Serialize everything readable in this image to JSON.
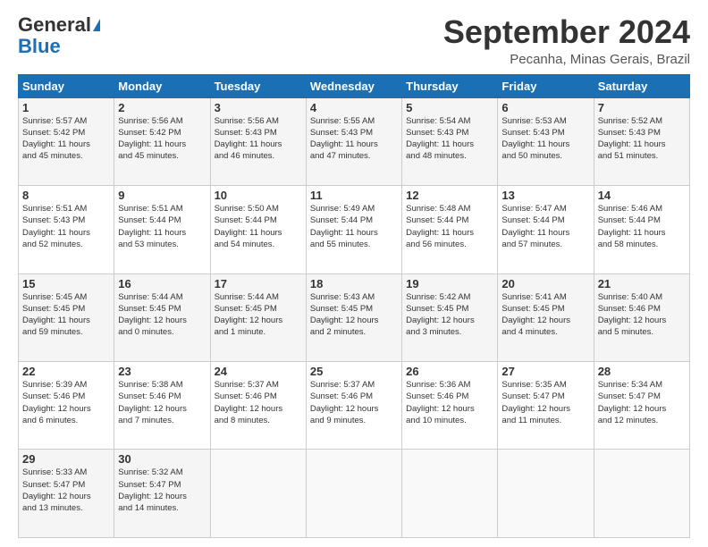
{
  "header": {
    "logo_line1": "General",
    "logo_line2": "Blue",
    "month": "September 2024",
    "location": "Pecanha, Minas Gerais, Brazil"
  },
  "weekdays": [
    "Sunday",
    "Monday",
    "Tuesday",
    "Wednesday",
    "Thursday",
    "Friday",
    "Saturday"
  ],
  "weeks": [
    [
      {
        "day": "1",
        "info": "Sunrise: 5:57 AM\nSunset: 5:42 PM\nDaylight: 11 hours\nand 45 minutes."
      },
      {
        "day": "2",
        "info": "Sunrise: 5:56 AM\nSunset: 5:42 PM\nDaylight: 11 hours\nand 45 minutes."
      },
      {
        "day": "3",
        "info": "Sunrise: 5:56 AM\nSunset: 5:43 PM\nDaylight: 11 hours\nand 46 minutes."
      },
      {
        "day": "4",
        "info": "Sunrise: 5:55 AM\nSunset: 5:43 PM\nDaylight: 11 hours\nand 47 minutes."
      },
      {
        "day": "5",
        "info": "Sunrise: 5:54 AM\nSunset: 5:43 PM\nDaylight: 11 hours\nand 48 minutes."
      },
      {
        "day": "6",
        "info": "Sunrise: 5:53 AM\nSunset: 5:43 PM\nDaylight: 11 hours\nand 50 minutes."
      },
      {
        "day": "7",
        "info": "Sunrise: 5:52 AM\nSunset: 5:43 PM\nDaylight: 11 hours\nand 51 minutes."
      }
    ],
    [
      {
        "day": "8",
        "info": "Sunrise: 5:51 AM\nSunset: 5:43 PM\nDaylight: 11 hours\nand 52 minutes."
      },
      {
        "day": "9",
        "info": "Sunrise: 5:51 AM\nSunset: 5:44 PM\nDaylight: 11 hours\nand 53 minutes."
      },
      {
        "day": "10",
        "info": "Sunrise: 5:50 AM\nSunset: 5:44 PM\nDaylight: 11 hours\nand 54 minutes."
      },
      {
        "day": "11",
        "info": "Sunrise: 5:49 AM\nSunset: 5:44 PM\nDaylight: 11 hours\nand 55 minutes."
      },
      {
        "day": "12",
        "info": "Sunrise: 5:48 AM\nSunset: 5:44 PM\nDaylight: 11 hours\nand 56 minutes."
      },
      {
        "day": "13",
        "info": "Sunrise: 5:47 AM\nSunset: 5:44 PM\nDaylight: 11 hours\nand 57 minutes."
      },
      {
        "day": "14",
        "info": "Sunrise: 5:46 AM\nSunset: 5:44 PM\nDaylight: 11 hours\nand 58 minutes."
      }
    ],
    [
      {
        "day": "15",
        "info": "Sunrise: 5:45 AM\nSunset: 5:45 PM\nDaylight: 11 hours\nand 59 minutes."
      },
      {
        "day": "16",
        "info": "Sunrise: 5:44 AM\nSunset: 5:45 PM\nDaylight: 12 hours\nand 0 minutes."
      },
      {
        "day": "17",
        "info": "Sunrise: 5:44 AM\nSunset: 5:45 PM\nDaylight: 12 hours\nand 1 minute."
      },
      {
        "day": "18",
        "info": "Sunrise: 5:43 AM\nSunset: 5:45 PM\nDaylight: 12 hours\nand 2 minutes."
      },
      {
        "day": "19",
        "info": "Sunrise: 5:42 AM\nSunset: 5:45 PM\nDaylight: 12 hours\nand 3 minutes."
      },
      {
        "day": "20",
        "info": "Sunrise: 5:41 AM\nSunset: 5:45 PM\nDaylight: 12 hours\nand 4 minutes."
      },
      {
        "day": "21",
        "info": "Sunrise: 5:40 AM\nSunset: 5:46 PM\nDaylight: 12 hours\nand 5 minutes."
      }
    ],
    [
      {
        "day": "22",
        "info": "Sunrise: 5:39 AM\nSunset: 5:46 PM\nDaylight: 12 hours\nand 6 minutes."
      },
      {
        "day": "23",
        "info": "Sunrise: 5:38 AM\nSunset: 5:46 PM\nDaylight: 12 hours\nand 7 minutes."
      },
      {
        "day": "24",
        "info": "Sunrise: 5:37 AM\nSunset: 5:46 PM\nDaylight: 12 hours\nand 8 minutes."
      },
      {
        "day": "25",
        "info": "Sunrise: 5:37 AM\nSunset: 5:46 PM\nDaylight: 12 hours\nand 9 minutes."
      },
      {
        "day": "26",
        "info": "Sunrise: 5:36 AM\nSunset: 5:46 PM\nDaylight: 12 hours\nand 10 minutes."
      },
      {
        "day": "27",
        "info": "Sunrise: 5:35 AM\nSunset: 5:47 PM\nDaylight: 12 hours\nand 11 minutes."
      },
      {
        "day": "28",
        "info": "Sunrise: 5:34 AM\nSunset: 5:47 PM\nDaylight: 12 hours\nand 12 minutes."
      }
    ],
    [
      {
        "day": "29",
        "info": "Sunrise: 5:33 AM\nSunset: 5:47 PM\nDaylight: 12 hours\nand 13 minutes."
      },
      {
        "day": "30",
        "info": "Sunrise: 5:32 AM\nSunset: 5:47 PM\nDaylight: 12 hours\nand 14 minutes."
      },
      null,
      null,
      null,
      null,
      null
    ]
  ]
}
